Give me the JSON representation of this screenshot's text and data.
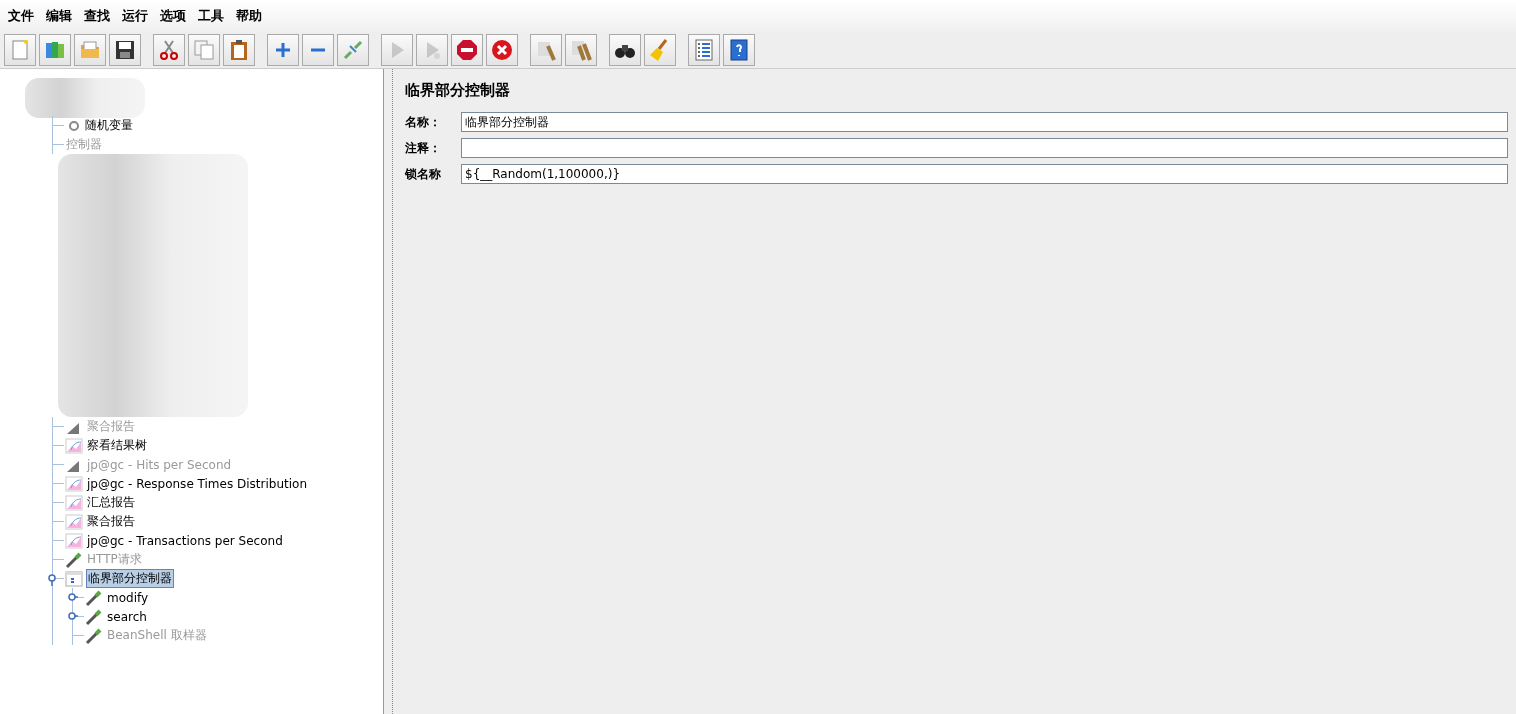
{
  "menu": [
    "文件",
    "编辑",
    "查找",
    "运行",
    "选项",
    "工具",
    "帮助"
  ],
  "toolbar": [
    [
      {
        "kind": "new",
        "disabled": false
      },
      {
        "kind": "templates",
        "disabled": false
      },
      {
        "kind": "open",
        "disabled": false
      },
      {
        "kind": "save",
        "disabled": false
      }
    ],
    [
      {
        "kind": "cut",
        "disabled": false
      },
      {
        "kind": "copy",
        "disabled": false
      },
      {
        "kind": "paste",
        "disabled": false
      }
    ],
    [
      {
        "kind": "expand",
        "disabled": false
      },
      {
        "kind": "collapse",
        "disabled": false
      },
      {
        "kind": "toggle",
        "disabled": false
      }
    ],
    [
      {
        "kind": "start",
        "disabled": true
      },
      {
        "kind": "start_no_pause",
        "disabled": true
      },
      {
        "kind": "stop",
        "disabled": false
      },
      {
        "kind": "shutdown",
        "disabled": false
      }
    ],
    [
      {
        "kind": "clear",
        "disabled": false
      },
      {
        "kind": "clear_all",
        "disabled": false
      }
    ],
    [
      {
        "kind": "search",
        "disabled": false
      },
      {
        "kind": "reset",
        "disabled": false
      }
    ],
    [
      {
        "kind": "function_helper",
        "disabled": false
      },
      {
        "kind": "help",
        "disabled": false
      }
    ]
  ],
  "tree": {
    "items": [
      {
        "kind": "blurred_header"
      },
      {
        "kind": "variable",
        "label": "随机变量",
        "disabled": false,
        "selected": false
      },
      {
        "kind": "plain",
        "label": "控制器",
        "disabled": true,
        "selected": false
      },
      {
        "kind": "blurred_rows"
      },
      {
        "kind": "graph",
        "label": "聚合报告",
        "disabled": true,
        "selected": false
      },
      {
        "kind": "chart",
        "label": "察看结果树",
        "disabled": false,
        "selected": false
      },
      {
        "kind": "graph",
        "label": "jp@gc - Hits per Second",
        "disabled": true,
        "selected": false
      },
      {
        "kind": "chart",
        "label": "jp@gc - Response Times Distribution",
        "disabled": false,
        "selected": false
      },
      {
        "kind": "chart",
        "label": "汇总报告",
        "disabled": false,
        "selected": false
      },
      {
        "kind": "chart",
        "label": "聚合报告",
        "disabled": false,
        "selected": false
      },
      {
        "kind": "chart",
        "label": "jp@gc - Transactions per Second",
        "disabled": false,
        "selected": false
      },
      {
        "kind": "sampler",
        "label": "HTTP请求",
        "disabled": true,
        "selected": false
      },
      {
        "kind": "controller",
        "label": "临界部分控制器",
        "disabled": false,
        "selected": true,
        "expanded": true,
        "children": [
          {
            "kind": "sampler",
            "label": "modify",
            "disabled": false,
            "selected": false,
            "expanded": false
          },
          {
            "kind": "sampler",
            "label": "search",
            "disabled": false,
            "selected": false,
            "expanded": false
          },
          {
            "kind": "sampler",
            "label": "BeanShell 取样器",
            "disabled": true,
            "selected": false
          }
        ]
      }
    ]
  },
  "panel": {
    "title": "临界部分控制器",
    "fields": [
      {
        "label": "名称：",
        "value": "临界部分控制器"
      },
      {
        "label": "注释："
      },
      {
        "label": "锁名称",
        "value": "${__Random(1,100000,)}"
      }
    ]
  }
}
